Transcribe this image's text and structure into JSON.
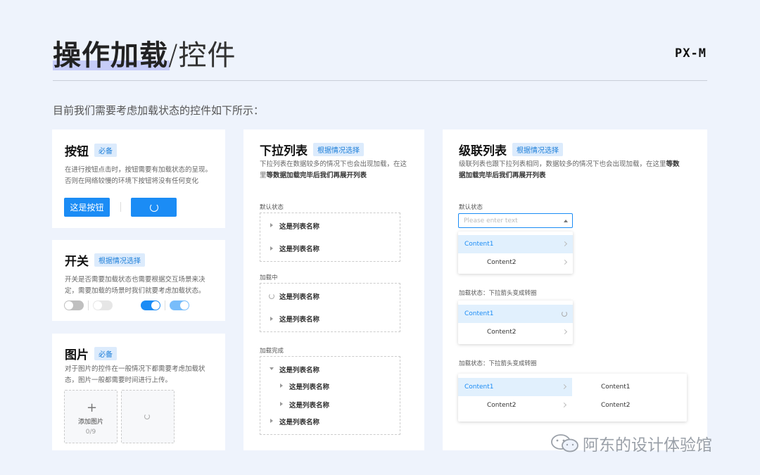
{
  "header": {
    "title_bold": "操作加载",
    "title_sep": "/",
    "title_sub": "控件",
    "brand": "PX-M",
    "intro": "目前我们需要考虑加载状态的控件如下所示："
  },
  "buttons_card": {
    "title": "按钮",
    "tag": "必备",
    "desc": "在进行按钮点击时，按钮需要有加载状态的呈现。否则在网络较慢的环境下按钮将没有任何变化",
    "button_label": "这是按钮"
  },
  "switch_card": {
    "title": "开关",
    "tag": "根据情况选择",
    "desc": "开关是否需要加载状态也需要根据交互场景来决定，需要加载的场景时我们就要考虑加载状态。"
  },
  "image_card": {
    "title": "图片",
    "tag": "必备",
    "desc": "对于图片的控件在一般情况下都需要考虑加载状态，图片一般都需要时间进行上传。",
    "add_label": "添加图片",
    "count": "0/9"
  },
  "dropdown_card": {
    "title": "下拉列表",
    "tag": "根据情况选择",
    "desc_a": "下拉列表在数据较多的情况下也会出现加载，在这里",
    "desc_b": "等数据加载完毕后我们再展开列表",
    "sections": [
      {
        "label": "默认状态",
        "items": [
          "这是列表名称",
          "这是列表名称"
        ]
      },
      {
        "label": "加载中",
        "items": [
          "这是列表名称",
          "这是列表名称"
        ]
      },
      {
        "label": "加载完成",
        "items": [
          "这是列表名称",
          "这是列表名称",
          "这是列表名称",
          "这是列表名称"
        ]
      }
    ]
  },
  "cascade_card": {
    "title": "级联列表",
    "tag": "根据情况选择",
    "desc_a": "级联列表也跟下拉列表相同，数据较多的情况下也会出现加载，在这里",
    "desc_b": "等数据加载完毕后我们再展开列表",
    "default_label": "默认状态",
    "placeholder": "Please enter text",
    "loading_label": "加载状态：下拉箭头变成转圈",
    "loaded_label": "加载状态：下拉箭头变成转圈",
    "option1": "Content1",
    "option2": "Content2"
  },
  "watermark": "阿东的设计体验馆",
  "colors": {
    "accent": "#1b8cf5",
    "background": "#eef3fc",
    "highlight": "#c6ccf8"
  }
}
